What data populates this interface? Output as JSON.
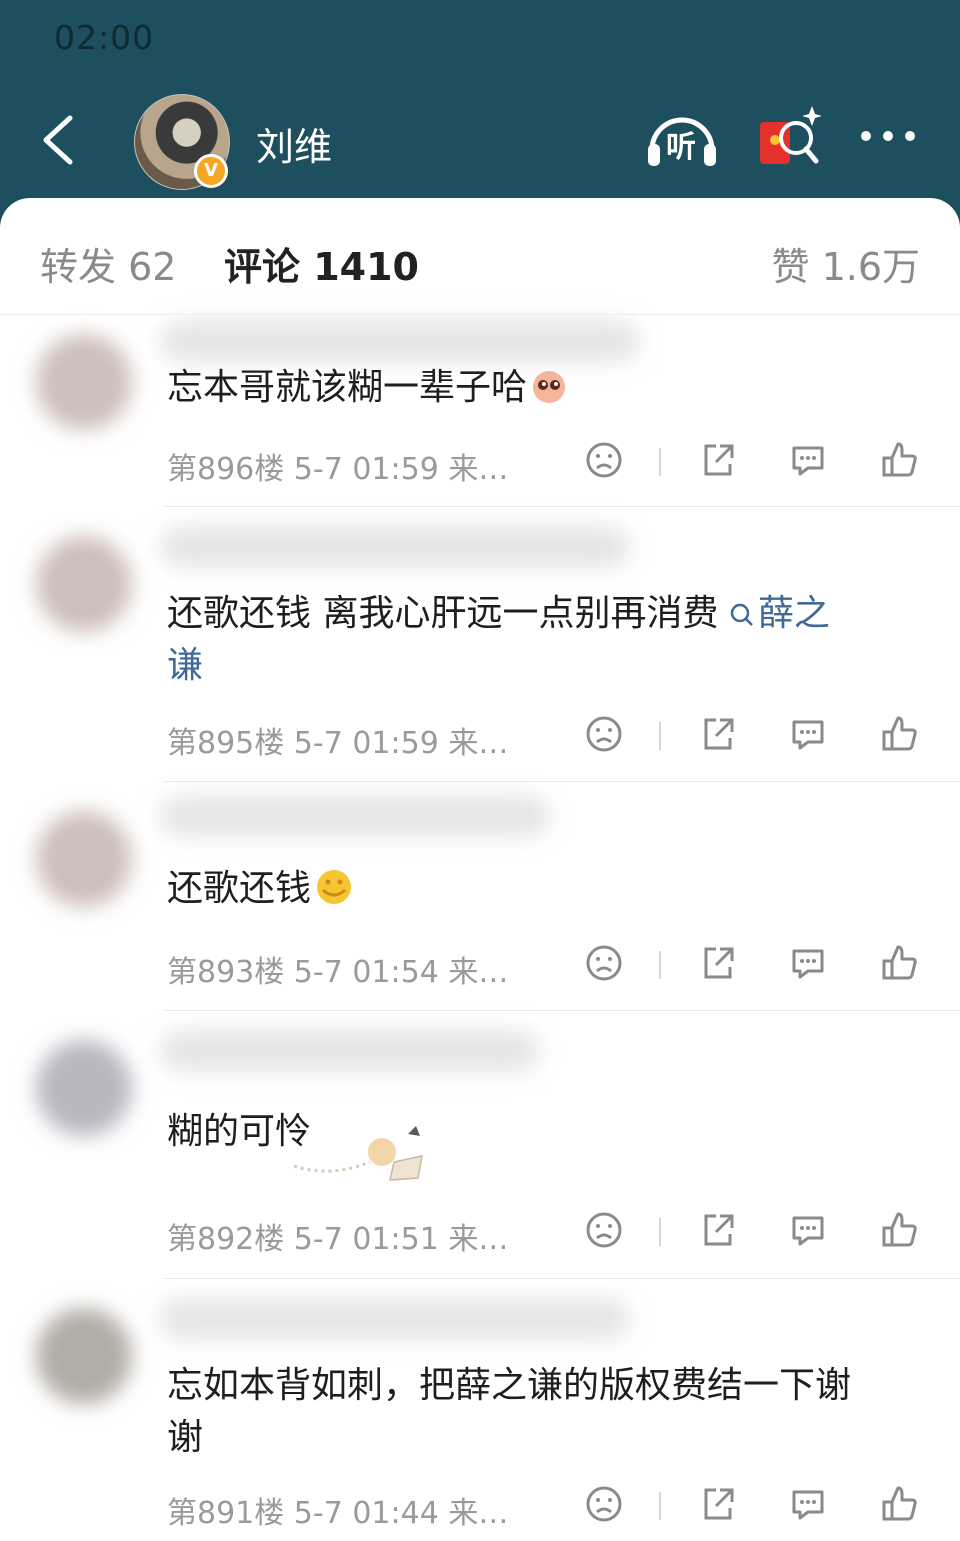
{
  "status_bar": {
    "time": "02:00"
  },
  "header": {
    "username": "刘维",
    "icons": [
      "back-arrow-icon",
      "verified-v-badge-icon",
      "listen-headphones-icon",
      "red-packet-search-icon",
      "more-dots-icon"
    ],
    "listen_label": "听",
    "verified_label": "V",
    "colors": {
      "background": "#1d4f5e",
      "badge": "#f5a623",
      "red_packet": "#e4312b"
    }
  },
  "tabs": {
    "repost": "转发 62",
    "comments": "评论 1410",
    "likes": "赞 1.6万"
  },
  "comments": [
    {
      "text": "忘本哥就该糊一辈子哈",
      "topic": "",
      "topic_cont": "",
      "emoji": "pleading-face-emoji",
      "meta": "第896楼  5-7 01:59  来…"
    },
    {
      "text": "还歌还钱 离我心肝远一点别再消费",
      "topic": "薛之",
      "topic_cont": "谦",
      "emoji": "",
      "meta": "第895楼  5-7 01:59  来…"
    },
    {
      "text": "还歌还钱",
      "topic": "",
      "topic_cont": "",
      "emoji": "yellow-face-emoji",
      "meta": "第893楼  5-7 01:54  来…"
    },
    {
      "text": "糊的可怜",
      "topic": "",
      "topic_cont": "",
      "emoji": "sticker-decoration",
      "meta": "第892楼  5-7 01:51  来…"
    },
    {
      "text": "忘如本背如刺，把薛之谦的版权费结一下谢",
      "topic": "",
      "topic_cont": "谢",
      "emoji": "",
      "meta": "第891楼  5-7 01:44  来…"
    }
  ],
  "comment_action_icons": [
    "dislike-face-icon",
    "share-icon",
    "reply-bubble-icon",
    "like-thumb-icon"
  ],
  "colors": {
    "topic_link": "#3f6a96",
    "meta_text": "#9a9a9a",
    "body_text": "#1e1e1e"
  }
}
